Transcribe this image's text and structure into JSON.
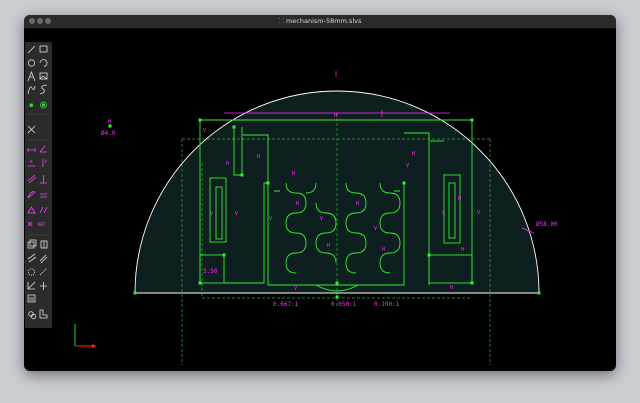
{
  "window": {
    "title": "mechanism-58mm.slvs",
    "file_icon": "sketch-file-icon"
  },
  "toolbar": {
    "tools": [
      "line-icon",
      "rectangle-icon",
      "circle-icon",
      "arc-icon",
      "text-icon",
      "image-icon",
      "spline-icon",
      "bezier-icon",
      "point-icon",
      "workplane-icon",
      "trim-icon",
      "distance-constraint-icon",
      "angle-constraint-icon",
      "horizontal-constraint-icon",
      "vertical-constraint-icon",
      "parallel-constraint-icon",
      "perpendicular-constraint-icon",
      "tangent-constraint-icon",
      "equal-constraint-icon",
      "midpoint-constraint-icon",
      "symmetric-constraint-icon",
      "extrude-icon",
      "lathe-icon",
      "revolve-icon",
      "helix-icon",
      "step-translate-icon",
      "step-rotate-icon",
      "nearest-ortho-icon",
      "nearest-iso-icon",
      "link-icon",
      "import-icon"
    ],
    "labels": {
      "ref": "REF"
    }
  },
  "sketch": {
    "dimensions": {
      "diameter_top": "Ø4.0",
      "diameter_arc": "Ø58.00",
      "small_len": "3.50",
      "ratio_left": "0.667:1",
      "ratio_mid": "0.050:1",
      "ratio_right": "0.100:1"
    },
    "constraint_labels": {
      "horizontal": "H",
      "vertical": "V"
    }
  },
  "colors": {
    "geometry": "#ffffff",
    "constraint": "#ff2bff",
    "point": "#33ee33",
    "construction": "#33aa33",
    "fill": "#0d1f1f",
    "axis_x": "#ff2222",
    "axis_y": "#22dd22"
  }
}
